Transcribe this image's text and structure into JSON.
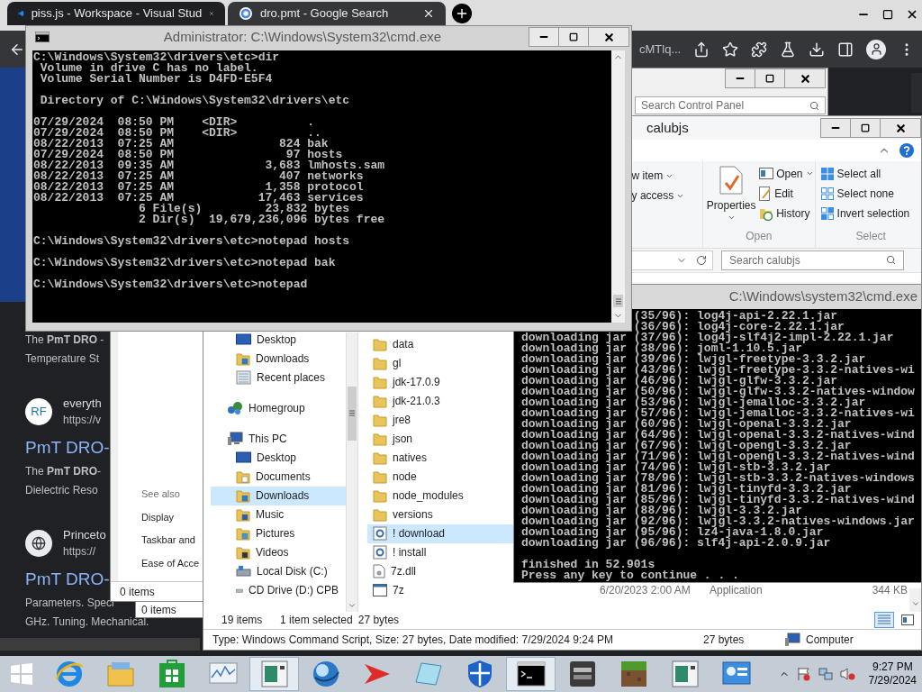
{
  "browser": {
    "tabs": [
      {
        "label": "piss.js - Workspace - Visual Stud",
        "selected": false,
        "kind": "editor"
      },
      {
        "label": "dro.pmt - Google Search",
        "selected": true,
        "kind": "search"
      }
    ],
    "address": "cMTlq...",
    "results": [
      {
        "kind": "snippet",
        "lines": [
          "The **PmT DRO** -",
          "Temperature St"
        ]
      },
      {
        "kind": "source",
        "badge": "RF",
        "name": "everyth",
        "url": "https://v"
      },
      {
        "kind": "title",
        "text": "PmT DRO-"
      },
      {
        "kind": "snippet",
        "lines": [
          "The **PmT DRO**-",
          "Dielectric Reso"
        ]
      },
      {
        "kind": "source",
        "name": "Princeto",
        "url": "https://"
      },
      {
        "kind": "title",
        "text": "PmT DRO-"
      },
      {
        "kind": "snippet",
        "lines": [
          "Parameters. Speci",
          "GHz. Tuning. Mechanical."
        ]
      }
    ]
  },
  "control_panel": {
    "search_placeholder": "Search Control Panel",
    "see_also": "See also",
    "links": [
      "Display",
      "Taskbar and",
      "Ease of Acce"
    ],
    "status": "0 items"
  },
  "background_window": {
    "status": "0 items"
  },
  "explorer": {
    "title": "calubjs",
    "ribbon": {
      "new_items": [
        {
          "label": "w item",
          "dropdown": true
        },
        {
          "label": "y access",
          "dropdown": true
        }
      ],
      "properties": "Properties",
      "open_items": [
        {
          "label": "Open",
          "dropdown": true,
          "kind": "open"
        },
        {
          "label": "Edit",
          "dropdown": false,
          "kind": "edit"
        },
        {
          "label": "History",
          "dropdown": false,
          "kind": "history"
        }
      ],
      "open_label": "Open",
      "select_items": [
        {
          "label": "Select all",
          "kind": "all"
        },
        {
          "label": "Select none",
          "kind": "none"
        },
        {
          "label": "Invert selection",
          "kind": "invert"
        }
      ],
      "select_label": "Select"
    },
    "search_placeholder": "Search calubjs",
    "nav": [
      {
        "children": [
          {
            "label": "Desktop",
            "kind": "desktop",
            "selected": false
          },
          {
            "label": "Downloads",
            "kind": "downloads",
            "selected": false
          },
          {
            "label": "Recent places",
            "kind": "recent",
            "selected": false
          }
        ]
      },
      {
        "label": "Homegroup",
        "kind": "homegroup",
        "selected": false
      },
      {
        "label": "This PC",
        "kind": "computer",
        "selected": false,
        "children": [
          {
            "label": "Desktop",
            "kind": "desktop",
            "selected": false
          },
          {
            "label": "Documents",
            "kind": "documents",
            "selected": false
          },
          {
            "label": "Downloads",
            "kind": "downloads",
            "selected": true
          },
          {
            "label": "Music",
            "kind": "music",
            "selected": false
          },
          {
            "label": "Pictures",
            "kind": "pictures",
            "selected": false
          },
          {
            "label": "Videos",
            "kind": "videos",
            "selected": false
          },
          {
            "label": "Local Disk (C:)",
            "kind": "disk",
            "selected": false
          },
          {
            "label": "CD Drive (D:) CPB",
            "kind": "cd",
            "selected": false
          }
        ]
      }
    ],
    "files": [
      {
        "name": "data",
        "kind": "folder",
        "selected": false
      },
      {
        "name": "gl",
        "kind": "folder",
        "selected": false
      },
      {
        "name": "jdk-17.0.9",
        "kind": "folder",
        "selected": false
      },
      {
        "name": "jdk-21.0.3",
        "kind": "folder",
        "selected": false
      },
      {
        "name": "jre8",
        "kind": "folder",
        "selected": false
      },
      {
        "name": "json",
        "kind": "folder",
        "selected": false
      },
      {
        "name": "natives",
        "kind": "folder",
        "selected": false
      },
      {
        "name": "node",
        "kind": "folder",
        "selected": false
      },
      {
        "name": "node_modules",
        "kind": "folder",
        "selected": false
      },
      {
        "name": "versions",
        "kind": "folder",
        "selected": false
      },
      {
        "name": "! download",
        "kind": "script",
        "selected": true
      },
      {
        "name": "! install",
        "kind": "script",
        "selected": false
      },
      {
        "name": "7z.dll",
        "kind": "dll",
        "selected": false
      },
      {
        "name": "7z",
        "kind": "app",
        "selected": false,
        "date": "6/20/2023 2:00 AM",
        "type": "Application",
        "size": "344 KB"
      }
    ],
    "status": {
      "count": "19 items",
      "selection": "1 item selected",
      "size": "27 bytes"
    },
    "details": {
      "summary": "Type: Windows Command Script, Size: 27 bytes, Date modified: 7/29/2024 9:24 PM",
      "size": "27 bytes",
      "location": "Computer"
    }
  },
  "cmd_admin": {
    "title": "Administrator: C:\\Windows\\System32\\cmd.exe",
    "blocks": [
      [
        "C:\\Windows\\System32\\drivers\\etc>dir",
        " Volume in drive C has no label.",
        " Volume Serial Number is D4FD-E5F4"
      ],
      [
        " Directory of C:\\Windows\\System32\\drivers\\etc"
      ],
      [
        "07/29/2024  08:50 PM    <DIR>          .",
        "07/29/2024  08:50 PM    <DIR>          ..",
        "08/22/2013  07:25 AM               824 bak",
        "07/29/2024  08:50 PM                97 hosts",
        "08/22/2013  09:35 AM             3,683 lmhosts.sam",
        "08/22/2013  07:25 AM               407 networks",
        "08/22/2013  07:25 AM             1,358 protocol",
        "08/22/2013  07:25 AM            17,463 services",
        "               6 File(s)         23,832 bytes",
        "               2 Dir(s)  19,679,236,096 bytes free"
      ],
      [
        "C:\\Windows\\System32\\drivers\\etc>notepad hosts"
      ],
      [
        "C:\\Windows\\System32\\drivers\\etc>notepad bak"
      ],
      [
        "C:\\Windows\\System32\\drivers\\etc>notepad"
      ]
    ]
  },
  "cmd_build": {
    "title": "C:\\Windows\\system32\\cmd.exe",
    "partial_lines": [
      "(35/96): log4j-api-2.22.1.jar",
      "(36/96): log4j-core-2.22.1.jar"
    ],
    "blocks": [
      [
        "downloading jar (37/96): log4j-slf4j2-impl-2.22.1.jar",
        "downloading jar (38/96): joml-1.10.5.jar",
        "downloading jar (39/96): lwjgl-freetype-3.3.2.jar",
        "downloading jar (43/96): lwjgl-freetype-3.3.2-natives-wi",
        "downloading jar (46/96): lwjgl-glfw-3.3.2.jar",
        "downloading jar (50/96): lwjgl-glfw-3.3.2-natives-window",
        "downloading jar (53/96): lwjgl-jemalloc-3.3.2.jar",
        "downloading jar (57/96): lwjgl-jemalloc-3.3.2-natives-wi",
        "downloading jar (60/96): lwjgl-openal-3.3.2.jar",
        "downloading jar (64/96): lwjgl-openal-3.3.2-natives-wind",
        "downloading jar (67/96): lwjgl-opengl-3.3.2.jar",
        "downloading jar (71/96): lwjgl-opengl-3.3.2-natives-wind",
        "downloading jar (74/96): lwjgl-stb-3.3.2.jar",
        "downloading jar (78/96): lwjgl-stb-3.3.2-natives-windows",
        "downloading jar (81/96): lwjgl-tinyfd-3.3.2.jar",
        "downloading jar (85/96): lwjgl-tinyfd-3.3.2-natives-wind",
        "downloading jar (88/96): lwjgl-3.3.2.jar",
        "downloading jar (92/96): lwjgl-3.3.2-natives-windows.jar",
        "downloading jar (95/96): lz4-java-1.8.0.jar",
        "downloading jar (96/96): slf4j-api-2.0.9.jar"
      ],
      [
        "finished in 52.901s",
        "Press any key to continue . . ."
      ]
    ]
  },
  "taskbar": {
    "apps": [
      {
        "kind": "ie",
        "active": false
      },
      {
        "kind": "explorer",
        "active": false
      },
      {
        "kind": "store",
        "active": false
      },
      {
        "kind": "monitor",
        "active": false
      },
      {
        "kind": "app",
        "active": true
      },
      {
        "kind": "globe",
        "active": false
      },
      {
        "kind": "arrow",
        "active": false
      },
      {
        "kind": "notepad",
        "active": false
      },
      {
        "kind": "shield",
        "active": false
      },
      {
        "kind": "cmd",
        "active": true
      },
      {
        "kind": "craft",
        "active": false
      },
      {
        "kind": "block",
        "active": false
      },
      {
        "kind": "app",
        "active": false
      },
      {
        "kind": "control",
        "active": false
      }
    ],
    "clock": {
      "time": "9:27 PM",
      "date": "7/29/2024"
    }
  }
}
